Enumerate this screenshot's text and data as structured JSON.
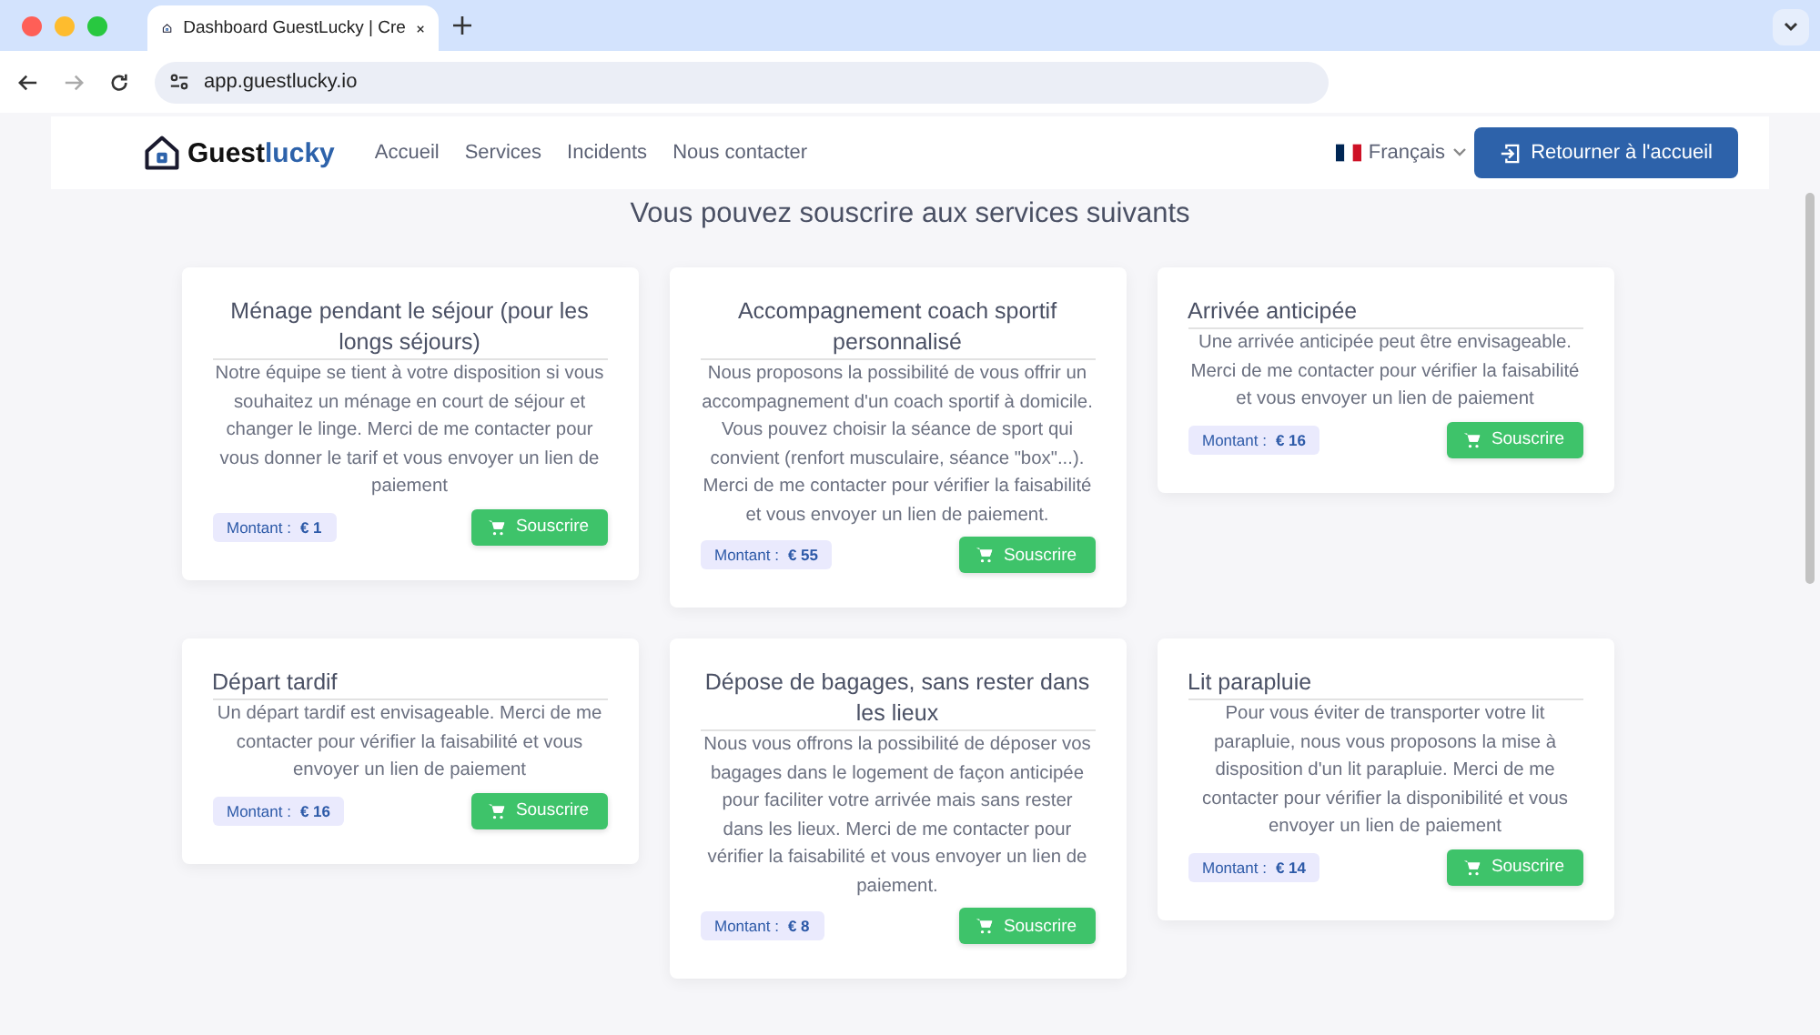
{
  "browser": {
    "tab_title": "Dashboard GuestLucky | Cre",
    "url": "app.guestlucky.io"
  },
  "header": {
    "logo": {
      "part_1": "Guest",
      "part_2": "lucky"
    },
    "nav": [
      {
        "label": "Accueil"
      },
      {
        "label": "Services"
      },
      {
        "label": "Incidents"
      },
      {
        "label": "Nous contacter"
      }
    ],
    "language": "Français",
    "home_button": "Retourner à l'accueil"
  },
  "heading": "Vous pouvez souscrire aux services suivants",
  "services": [
    {
      "title": "Ménage pendant le séjour (pour les longs séjours)",
      "kind": "centered",
      "description": "Notre équipe se tient à votre disposition si vous souhaitez un ménage en court de séjour et changer le linge. Merci de me contacter pour vous donner le tarif et vous envoyer un lien de paiement",
      "amount_label": "Montant :",
      "amount": "€ 1",
      "button": "Souscrire"
    },
    {
      "title": "Accompagnement coach sportif personnalisé",
      "kind": "centered",
      "description": "Nous proposons la possibilité de vous offrir un accompagnement d'un coach sportif à domicile. Vous pouvez choisir la séance de sport qui convient (renfort musculaire, séance \"box\"...). Merci de me contacter pour vérifier la faisabilité et vous envoyer un lien de paiement.",
      "amount_label": "Montant :",
      "amount": "€ 55",
      "button": "Souscrire"
    },
    {
      "title": "Arrivée anticipée",
      "kind": "left",
      "description": "Une arrivée anticipée peut être envisageable. Merci de me contacter pour vérifier la faisabilité et vous envoyer un lien de paiement",
      "amount_label": "Montant :",
      "amount": "€ 16",
      "button": "Souscrire"
    },
    {
      "title": "Départ tardif",
      "kind": "left",
      "description": "Un départ tardif est envisageable. Merci de me contacter pour vérifier la faisabilité et vous envoyer un lien de paiement",
      "amount_label": "Montant :",
      "amount": "€ 16",
      "button": "Souscrire"
    },
    {
      "title": "Dépose de bagages, sans rester dans les lieux",
      "kind": "centered",
      "description": "Nous vous offrons la possibilité de déposer vos bagages dans le logement de façon anticipée pour faciliter votre arrivée mais sans rester dans les lieux. Merci de me contacter pour vérifier la faisabilité et vous envoyer un lien de paiement.",
      "amount_label": "Montant :",
      "amount": "€ 8",
      "button": "Souscrire"
    },
    {
      "title": "Lit parapluie",
      "kind": "left",
      "description": "Pour vous éviter de transporter votre lit parapluie, nous vous proposons la mise à disposition d'un lit parapluie. Merci de me contacter pour vérifier la disponibilité et vous envoyer un lien de paiement",
      "amount_label": "Montant :",
      "amount": "€ 14",
      "button": "Souscrire"
    }
  ]
}
